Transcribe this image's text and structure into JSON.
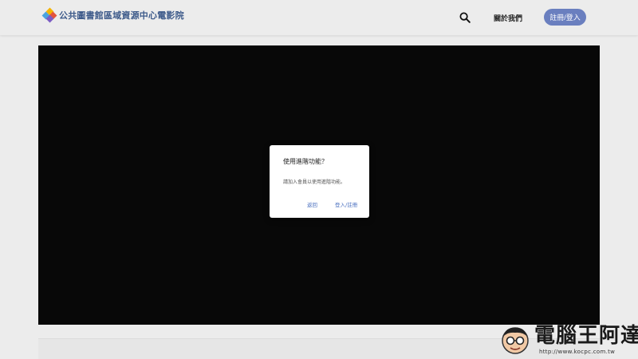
{
  "header": {
    "site_title": "公共圖書館區域資源中心電影院",
    "about_label": "關於我們",
    "signup_label": "註冊/登入"
  },
  "icons": {
    "search": "search-icon",
    "logo": "diamond-logo-icon"
  },
  "dialog": {
    "title": "使用進階功能？",
    "message": "請加入會員以使用進階功能。",
    "back_label": "返回",
    "login_label": "登入/註冊"
  },
  "watermark": {
    "text": "電腦王阿達",
    "url": "http://www.kocpc.com.tw"
  },
  "colors": {
    "accent": "#6a7fbf",
    "link": "#4a6fbf",
    "player_bg": "#080808",
    "page_bg": "#ececec"
  }
}
